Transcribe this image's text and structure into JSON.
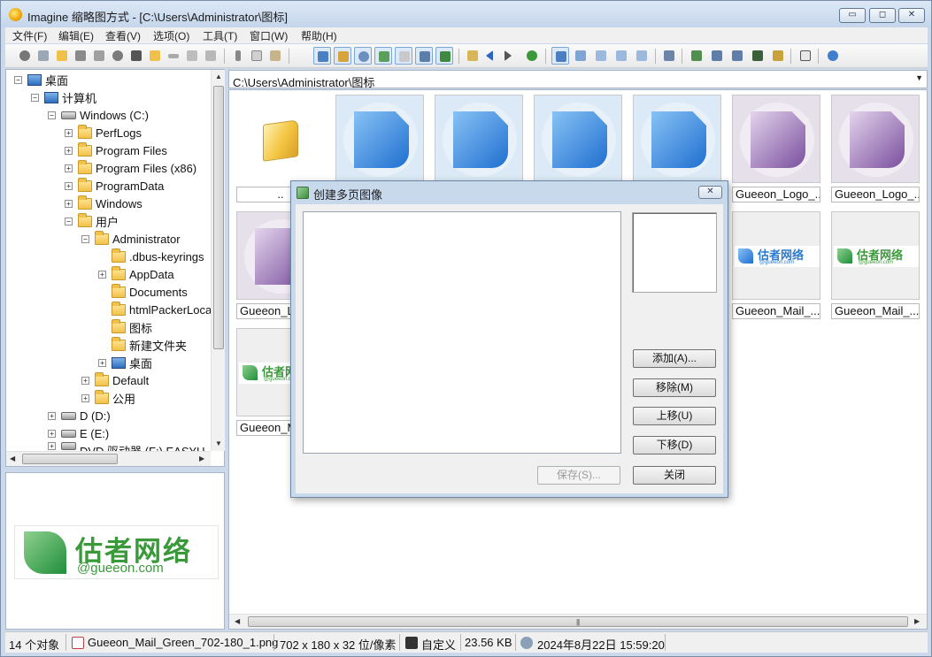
{
  "window": {
    "title": "Imagine 缩略图方式 - [C:\\Users\\Administrator\\图标]",
    "min_label": "▭",
    "max_label": "◻",
    "close_label": "✕"
  },
  "menu": [
    "文件(F)",
    "编辑(E)",
    "查看(V)",
    "选项(O)",
    "工具(T)",
    "窗口(W)",
    "帮助(H)"
  ],
  "tree": {
    "items": [
      {
        "label": "桌面",
        "expander": "−"
      },
      {
        "label": "计算机",
        "expander": "−"
      },
      {
        "label": "Windows (C:)",
        "expander": "−"
      },
      {
        "label": "PerfLogs",
        "expander": "+"
      },
      {
        "label": "Program Files",
        "expander": "+"
      },
      {
        "label": "Program Files (x86)",
        "expander": "+"
      },
      {
        "label": "ProgramData",
        "expander": "+"
      },
      {
        "label": "Windows",
        "expander": "+"
      },
      {
        "label": "用户",
        "expander": "−"
      },
      {
        "label": "Administrator",
        "expander": "−"
      },
      {
        "label": ".dbus-keyrings",
        "expander": ""
      },
      {
        "label": "AppData",
        "expander": "+"
      },
      {
        "label": "Documents",
        "expander": ""
      },
      {
        "label": "htmlPackerLoca",
        "expander": ""
      },
      {
        "label": "图标",
        "expander": ""
      },
      {
        "label": "新建文件夹",
        "expander": ""
      },
      {
        "label": "桌面",
        "expander": "+"
      },
      {
        "label": "Default",
        "expander": "+"
      },
      {
        "label": "公用",
        "expander": "+"
      },
      {
        "label": "D (D:)",
        "expander": "+"
      },
      {
        "label": "E (E:)",
        "expander": "+"
      },
      {
        "label": "DVD 驱动器 (F:) EASYU_V:",
        "expander": "+"
      }
    ]
  },
  "preview": {
    "logo_cn": "估者网络",
    "logo_en": "@gueeon.com"
  },
  "address": {
    "path": "C:\\Users\\Administrator\\图标",
    "dropdown": "▼"
  },
  "thumbnails": {
    "parent_label": "..",
    "items": [
      {
        "label": "",
        "kind": "blue-doc"
      },
      {
        "label": "",
        "kind": "blue-doc"
      },
      {
        "label": "",
        "kind": "blue-doc"
      },
      {
        "label": "",
        "kind": "blue-doc"
      },
      {
        "label": "Gueeon_Logo_...",
        "kind": "purple-doc"
      },
      {
        "label": "Gueeon_Logo_...",
        "kind": "purple-doc"
      },
      {
        "label": "Gueeon_Lo",
        "kind": "purple-doc"
      },
      {
        "label": "Gueeon_Mail_...",
        "kind": "mail-blue"
      },
      {
        "label": "Gueeon_Mail_...",
        "kind": "mail-green"
      },
      {
        "label": "Gueeon_M",
        "kind": "mail-green"
      }
    ],
    "mail_logo_cn": "估者网络",
    "mail_logo_en": "@gueeon.com"
  },
  "dialog": {
    "title": "创建多页图像",
    "close_label": "✕",
    "buttons": {
      "add": "添加(A)...",
      "remove": "移除(M)",
      "move_up": "上移(U)",
      "move_down": "下移(D)",
      "save": "保存(S)...",
      "close": "关闭"
    }
  },
  "status": {
    "count": "14 个对象",
    "filename": "Gueeon_Mail_Green_702-180_1.png",
    "dimensions": "702 x 180 x 32 位/像素",
    "custom": "自定义",
    "size": "23.56 KB",
    "datetime": "2024年8月22日 15:59:20"
  }
}
